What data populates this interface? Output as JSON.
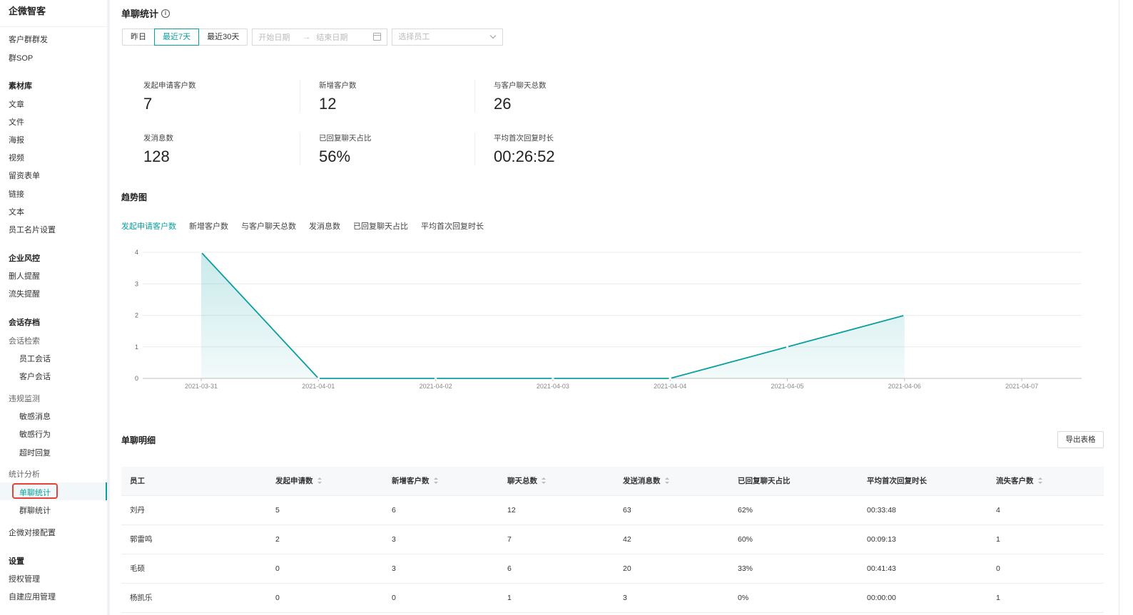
{
  "app": {
    "brand": "企微智客"
  },
  "sidebar": {
    "items": [
      {
        "label": "客户群群发",
        "type": "item"
      },
      {
        "label": "群SOP",
        "type": "item"
      },
      {
        "label": "素材库",
        "type": "group"
      },
      {
        "label": "文章",
        "type": "item"
      },
      {
        "label": "文件",
        "type": "item"
      },
      {
        "label": "海报",
        "type": "item"
      },
      {
        "label": "视频",
        "type": "item"
      },
      {
        "label": "留资表单",
        "type": "item"
      },
      {
        "label": "链接",
        "type": "item"
      },
      {
        "label": "文本",
        "type": "item"
      },
      {
        "label": "员工名片设置",
        "type": "item"
      },
      {
        "label": "企业风控",
        "type": "group"
      },
      {
        "label": "删人提醒",
        "type": "item"
      },
      {
        "label": "流失提醒",
        "type": "item"
      },
      {
        "label": "会话存档",
        "type": "group"
      },
      {
        "label": "会话检索",
        "type": "sub"
      },
      {
        "label": "员工会话",
        "type": "child"
      },
      {
        "label": "客户会话",
        "type": "child"
      },
      {
        "label": "违规监测",
        "type": "sub"
      },
      {
        "label": "敏感消息",
        "type": "child"
      },
      {
        "label": "敏感行为",
        "type": "child"
      },
      {
        "label": "超时回复",
        "type": "child"
      },
      {
        "label": "统计分析",
        "type": "sub"
      },
      {
        "label": "单聊统计",
        "type": "child",
        "active": true
      },
      {
        "label": "群聊统计",
        "type": "child"
      },
      {
        "label": "企微对接配置",
        "type": "item"
      },
      {
        "label": "设置",
        "type": "group"
      },
      {
        "label": "授权管理",
        "type": "item"
      },
      {
        "label": "自建应用管理",
        "type": "item"
      }
    ]
  },
  "page": {
    "title": "单聊统计"
  },
  "filters": {
    "ranges": [
      {
        "label": "昨日",
        "active": false
      },
      {
        "label": "最近7天",
        "active": true
      },
      {
        "label": "最近30天",
        "active": false
      }
    ],
    "start_placeholder": "开始日期",
    "end_placeholder": "结束日期",
    "staff_placeholder": "选择员工"
  },
  "stats": [
    {
      "label": "发起申请客户数",
      "value": "7"
    },
    {
      "label": "新增客户数",
      "value": "12"
    },
    {
      "label": "与客户聊天总数",
      "value": "26"
    },
    {
      "label": "发消息数",
      "value": "128"
    },
    {
      "label": "已回复聊天占比",
      "value": "56%"
    },
    {
      "label": "平均首次回复时长",
      "value": "00:26:52"
    }
  ],
  "trend": {
    "title": "趋势图",
    "tabs": [
      {
        "label": "发起申请客户数",
        "active": true
      },
      {
        "label": "新增客户数",
        "active": false
      },
      {
        "label": "与客户聊天总数",
        "active": false
      },
      {
        "label": "发消息数",
        "active": false
      },
      {
        "label": "已回复聊天占比",
        "active": false
      },
      {
        "label": "平均首次回复时长",
        "active": false
      }
    ]
  },
  "chart_data": {
    "type": "area",
    "categories": [
      "2021-03-31",
      "2021-04-01",
      "2021-04-02",
      "2021-04-03",
      "2021-04-04",
      "2021-04-05",
      "2021-04-06",
      "2021-04-07"
    ],
    "values": [
      4,
      0,
      0,
      0,
      0,
      1,
      2,
      null
    ],
    "yticks": [
      0,
      1,
      2,
      3,
      4
    ],
    "ylim": [
      0,
      4
    ],
    "grid": true,
    "color": "#0a9ea0"
  },
  "detail": {
    "title": "单聊明细",
    "export_label": "导出表格",
    "columns": [
      {
        "label": "员工",
        "sortable": false
      },
      {
        "label": "发起申请数",
        "sortable": true
      },
      {
        "label": "新增客户数",
        "sortable": true
      },
      {
        "label": "聊天总数",
        "sortable": true
      },
      {
        "label": "发送消息数",
        "sortable": true
      },
      {
        "label": "已回复聊天占比",
        "sortable": false
      },
      {
        "label": "平均首次回复时长",
        "sortable": false
      },
      {
        "label": "流失客户数",
        "sortable": true
      }
    ],
    "rows": [
      [
        "刘丹",
        "5",
        "6",
        "12",
        "63",
        "62%",
        "00:33:48",
        "4"
      ],
      [
        "郭雷鸣",
        "2",
        "3",
        "7",
        "42",
        "60%",
        "00:09:13",
        "1"
      ],
      [
        "毛硕",
        "0",
        "3",
        "6",
        "20",
        "33%",
        "00:41:43",
        "0"
      ],
      [
        "杨凯乐",
        "0",
        "0",
        "1",
        "3",
        "0%",
        "00:00:00",
        "1"
      ]
    ]
  }
}
